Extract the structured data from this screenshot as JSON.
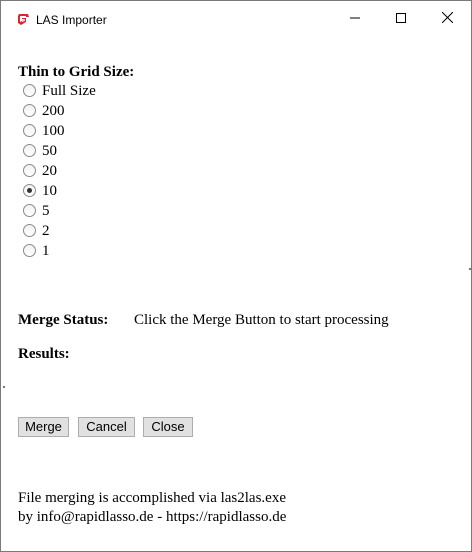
{
  "window": {
    "title": "LAS Importer",
    "app_icon": "sketchup-logo-icon",
    "controls": {
      "minimize": "minimize-icon",
      "maximize": "maximize-icon",
      "close": "close-icon"
    }
  },
  "grid": {
    "heading": "Thin to Grid Size:",
    "options": [
      {
        "label": "Full Size",
        "checked": false
      },
      {
        "label": "200",
        "checked": false
      },
      {
        "label": "100",
        "checked": false
      },
      {
        "label": "50",
        "checked": false
      },
      {
        "label": "20",
        "checked": false
      },
      {
        "label": "10",
        "checked": true
      },
      {
        "label": "5",
        "checked": false
      },
      {
        "label": "2",
        "checked": false
      },
      {
        "label": "1",
        "checked": false
      }
    ]
  },
  "status": {
    "label": "Merge Status:",
    "text": "Click the Merge Button to start processing"
  },
  "results": {
    "label": "Results:"
  },
  "buttons": {
    "merge": "Merge",
    "cancel": "Cancel",
    "close": "Close"
  },
  "footer": {
    "line1": "File merging is accomplished via las2las.exe",
    "line2": "by info@rapidlasso.de - https://rapidlasso.de"
  },
  "colors": {
    "app_icon_red": "#d9262c",
    "button_bg": "#e1e1e1",
    "border": "#7a7a7a"
  }
}
